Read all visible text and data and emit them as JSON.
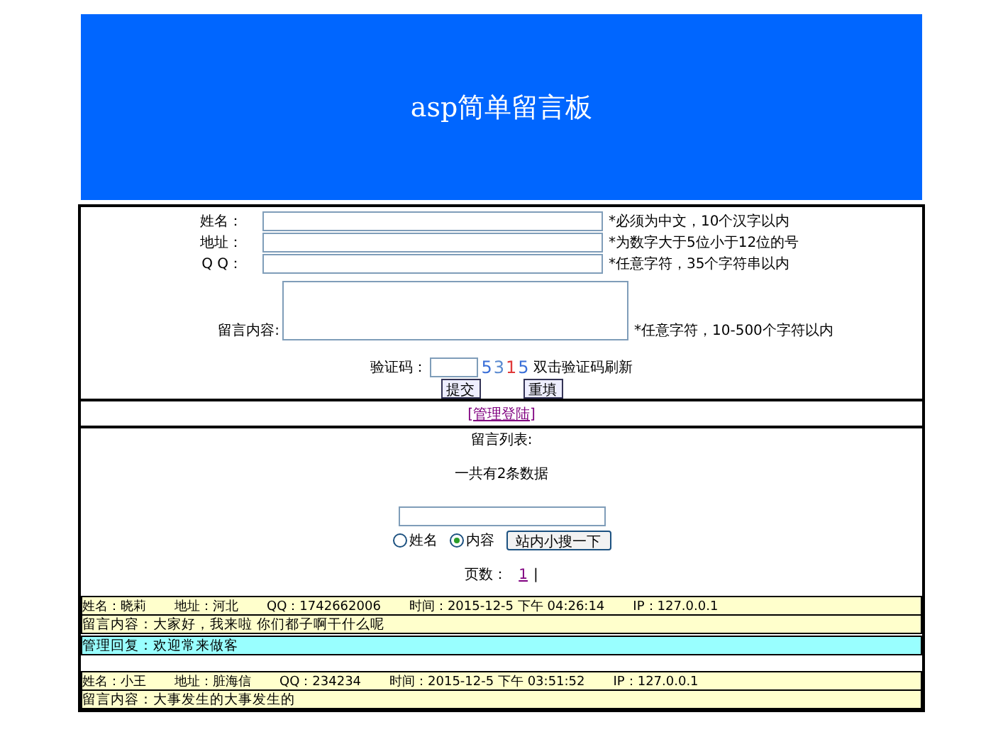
{
  "header": {
    "title": "asp简单留言板"
  },
  "form": {
    "fields": [
      {
        "kind": "input",
        "label": "姓名：",
        "note": "*必须为中文，10个汉字以内"
      },
      {
        "kind": "input",
        "label": "地址：",
        "note": "*为数字大于5位小于12位的号"
      },
      {
        "kind": "input",
        "label": "Q Q：",
        "note": "*任意字符，35个字符串以内"
      },
      {
        "kind": "textarea",
        "label": "留言内容:",
        "note": "*任意字符，10-500个字符以内"
      }
    ],
    "captcha": {
      "label": "验证码：",
      "digits": [
        {
          "text": "5",
          "color": "#3a6fd8"
        },
        {
          "text": "3",
          "color": "#5a8ad0"
        },
        {
          "text": "1",
          "color": "#e03a3a"
        },
        {
          "text": "5",
          "color": "#3a6fd8"
        }
      ],
      "hint": "双击验证码刷新"
    },
    "buttons": [
      "提交",
      "重填"
    ]
  },
  "admin_link": "[管理登陆]",
  "list": {
    "title": "留言列表:",
    "count": "一共有2条数据",
    "search": {
      "options": [
        {
          "label": "姓名",
          "selected": false
        },
        {
          "label": "内容",
          "selected": true
        }
      ],
      "button": "站内小搜一下"
    },
    "pages_label": "页数：",
    "pages": [
      "1"
    ],
    "page_sep": "|"
  },
  "messages": [
    {
      "info": [
        "姓名：晓莉",
        "地址：河北",
        "QQ：1742662006",
        "时间：2015-12-5 下午 04:26:14",
        "IP：127.0.0.1"
      ],
      "content": "留言内容：大家好，我来啦  你们都子啊干什么呢",
      "reply": "管理回复：欢迎常来做客"
    },
    {
      "info": [
        "姓名：小王",
        "地址：脏海信",
        "QQ：234234",
        "时间：2015-12-5 下午 03:51:52",
        "IP：127.0.0.1"
      ],
      "content": "留言内容：大事发生的大事发生的"
    }
  ]
}
